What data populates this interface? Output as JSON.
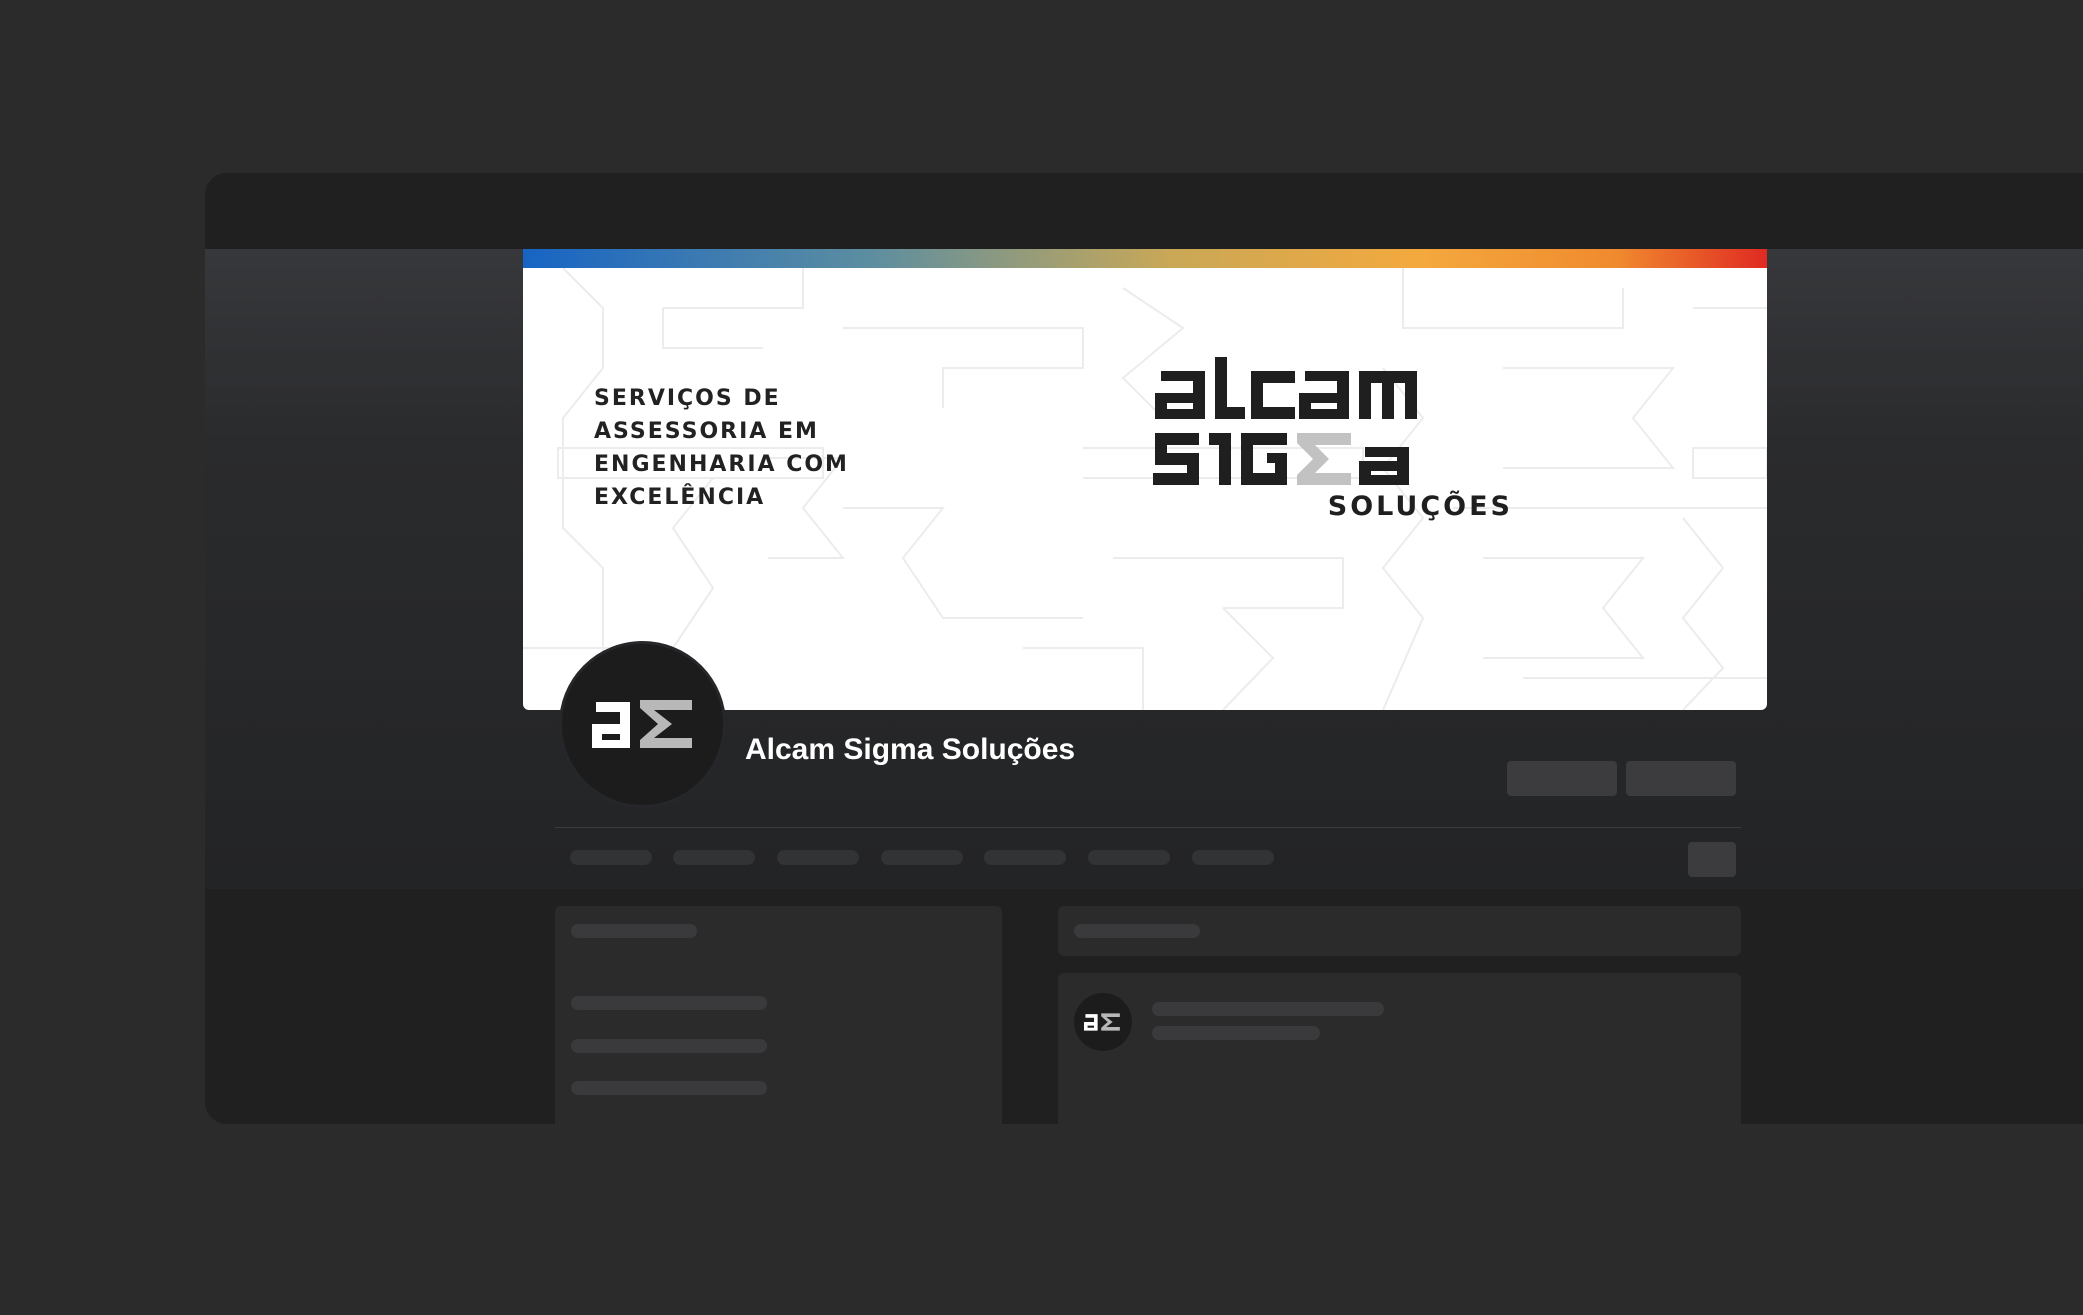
{
  "cover": {
    "tagline_lines": [
      "SERVIÇOS DE",
      "ASSESSORIA EM",
      "ENGENHARIA COM",
      "EXCELÊNCIA"
    ],
    "logo": {
      "line1": "alcam",
      "line2": "sigma",
      "subtitle": "SOLUÇÕES"
    },
    "stripe_colors": [
      "#1764c4",
      "#5d8ea0",
      "#c9a857",
      "#f4a93e",
      "#f08a2e",
      "#e02a22"
    ]
  },
  "profile": {
    "page_name": "Alcam Sigma Soluções",
    "avatar_icon": "alcam-sigma-monogram-icon"
  },
  "colors": {
    "background": "#2b2b2b",
    "window": "#232425",
    "placeholder": "#3a3a3c",
    "monogram_accent": "#b8b8b8"
  }
}
